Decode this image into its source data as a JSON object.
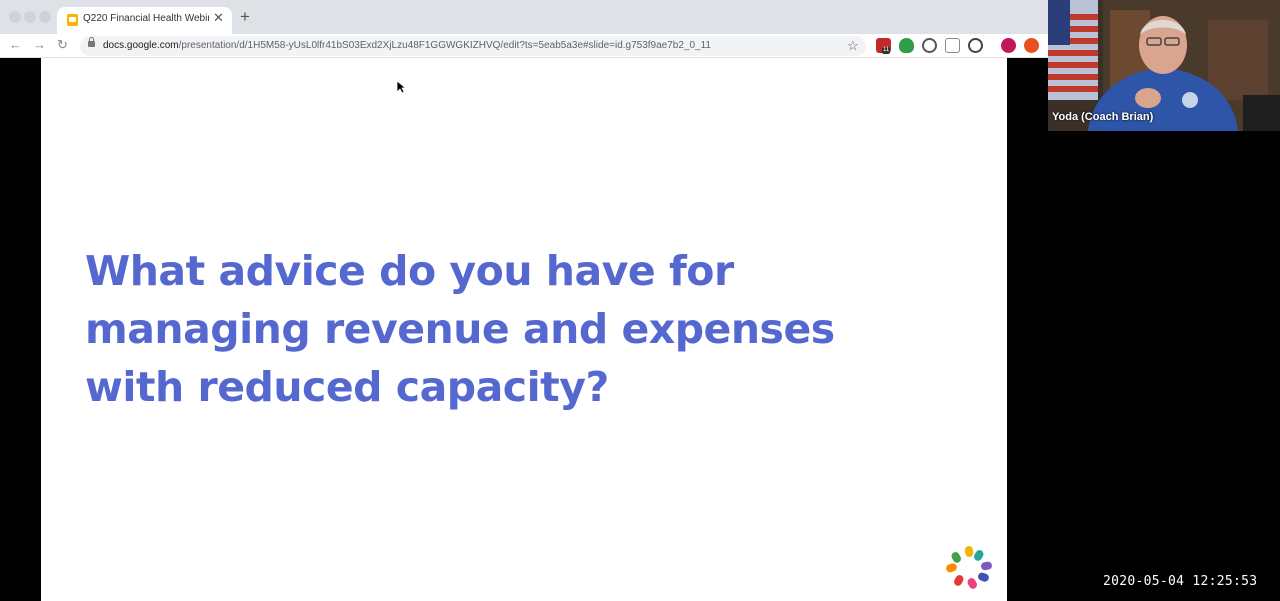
{
  "browser": {
    "tab": {
      "title": "Q220 Financial Health Webinar"
    },
    "address": {
      "host": "docs.google.com",
      "path": "/presentation/d/1H5M58-yUsL0lfr41bS03Exd2XjLzu48F1GGWGKIZHVQ/edit?ts=5eab5a3e#slide=id.g753f9ae7b2_0_11"
    },
    "extension_badge": "11"
  },
  "slide": {
    "lines": [
      "What advice do you have for",
      "managing revenue and expenses",
      "with reduced capacity?"
    ]
  },
  "video": {
    "participant_name": "Yoda (Coach Brian)"
  },
  "recording": {
    "timestamp": "2020-05-04  12:25:53"
  },
  "colors": {
    "slide_title": "#5568cf",
    "tab_strip": "#dee1e6"
  },
  "icons": [
    "back-icon",
    "forward-icon",
    "reload-icon",
    "lock-icon",
    "star-icon",
    "close-icon",
    "new-tab-icon"
  ]
}
